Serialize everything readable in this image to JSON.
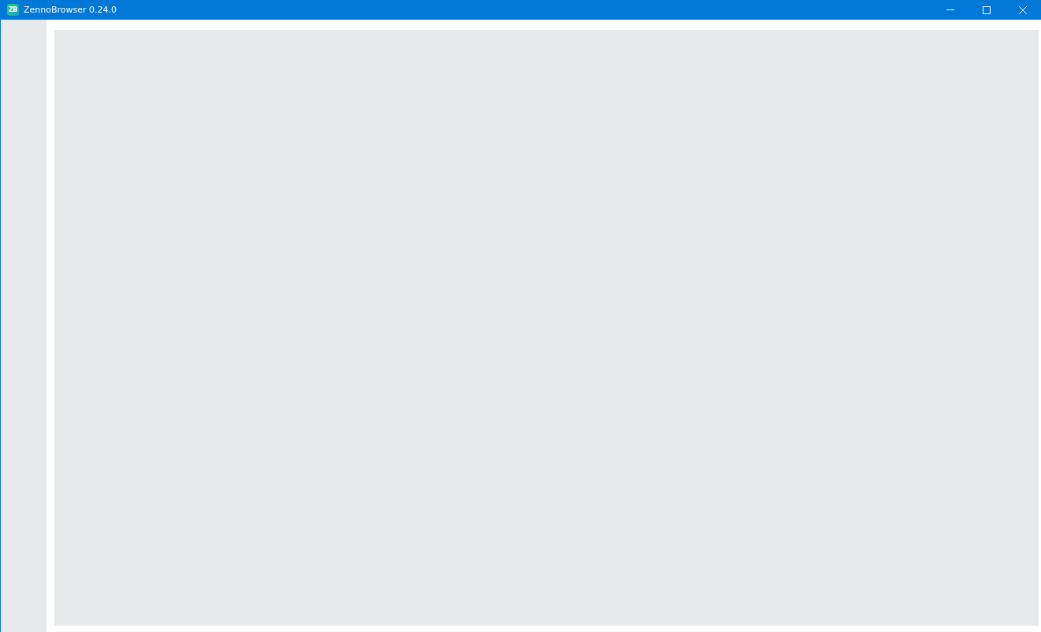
{
  "window": {
    "title": "ZennoBrowser 0.24.0",
    "logo": "ZB"
  }
}
